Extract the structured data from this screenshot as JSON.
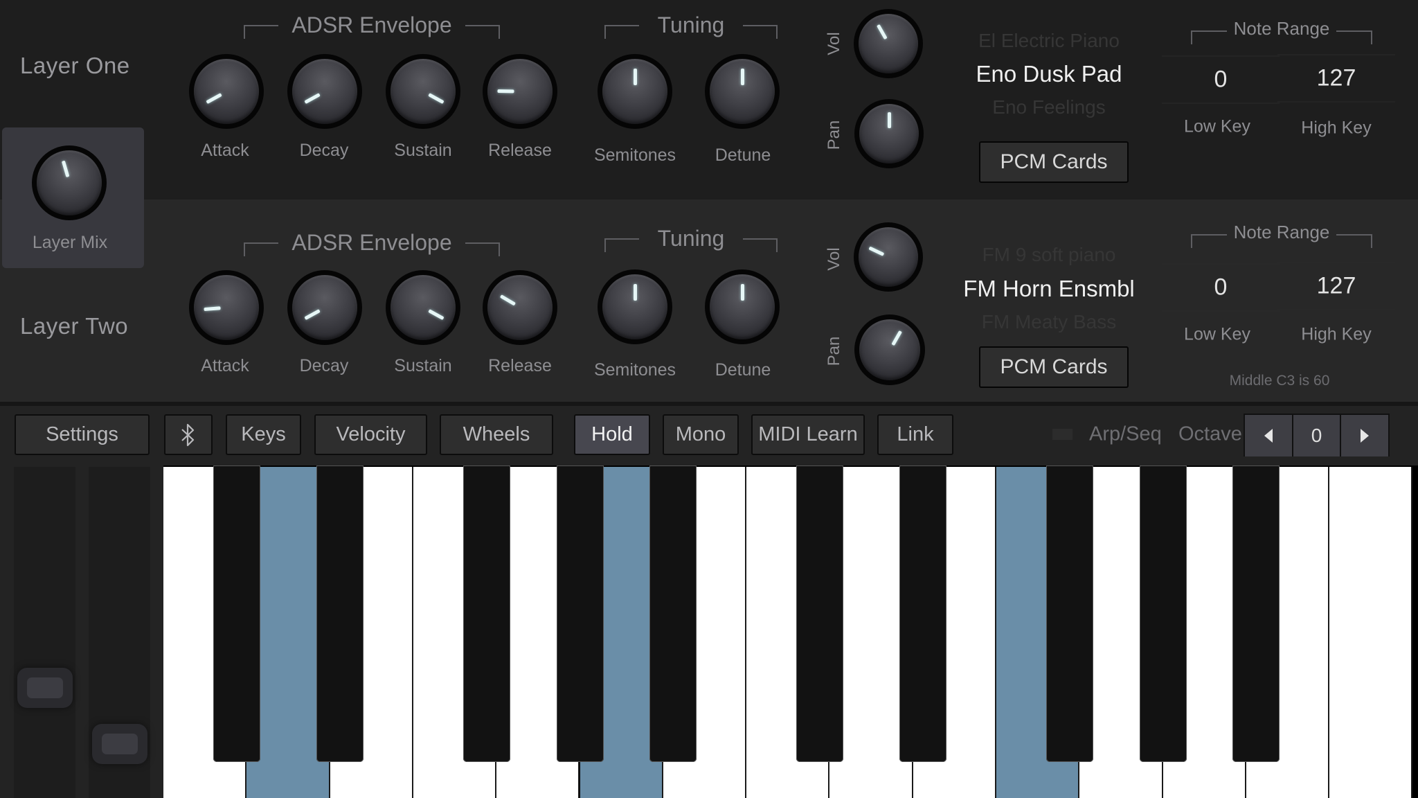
{
  "layers": [
    {
      "title": "Layer One",
      "adsr": {
        "title": "ADSR Envelope",
        "knobs": [
          {
            "label": "Attack",
            "value": 0.06
          },
          {
            "label": "Decay",
            "value": 0.06
          },
          {
            "label": "Sustain",
            "value": 0.94
          },
          {
            "label": "Release",
            "value": 0.17
          }
        ]
      },
      "tuning": {
        "title": "Tuning",
        "knobs": [
          {
            "label": "Semitones",
            "value": 0.5
          },
          {
            "label": "Detune",
            "value": 0.5
          }
        ]
      },
      "vol": {
        "label": "Vol",
        "value": 0.39
      },
      "pan": {
        "label": "Pan",
        "value": 0.5
      },
      "preset": {
        "above": "El Electric Piano",
        "selected": "Eno Dusk Pad",
        "below": "Eno Feelings"
      },
      "bank_button": "PCM Cards",
      "note_range": {
        "title": "Note Range",
        "low": "0",
        "high": "127",
        "low_label": "Low Key",
        "high_label": "High Key"
      }
    },
    {
      "title": "Layer Two",
      "adsr": {
        "title": "ADSR Envelope",
        "knobs": [
          {
            "label": "Attack",
            "value": 0.15
          },
          {
            "label": "Decay",
            "value": 0.06
          },
          {
            "label": "Sustain",
            "value": 0.94
          },
          {
            "label": "Release",
            "value": 0.28
          }
        ]
      },
      "tuning": {
        "title": "Tuning",
        "knobs": [
          {
            "label": "Semitones",
            "value": 0.5
          },
          {
            "label": "Detune",
            "value": 0.5
          }
        ]
      },
      "vol": {
        "label": "Vol",
        "value": 0.26
      },
      "pan": {
        "label": "Pan",
        "value": 0.61
      },
      "preset": {
        "above": "FM 9 soft piano",
        "selected": "FM Horn Ensmbl",
        "below": "FM Meaty Bass"
      },
      "bank_button": "PCM Cards",
      "note_range": {
        "title": "Note Range",
        "low": "0",
        "high": "127",
        "low_label": "Low Key",
        "high_label": "High Key"
      },
      "hint": "Middle C3 is 60"
    }
  ],
  "layer_mix": {
    "label": "Layer Mix",
    "value": 0.44
  },
  "toolbar": {
    "settings": "Settings",
    "bluetooth_icon": "bluetooth-icon",
    "keys": "Keys",
    "velocity": "Velocity",
    "wheels": "Wheels",
    "hold": "Hold",
    "hold_active": true,
    "mono": "Mono",
    "midi_learn": "MIDI Learn",
    "link": "Link",
    "arp_seq": "Arp/Seq",
    "arp_seq_on": false,
    "octave_label": "Octave",
    "octave_value": "0",
    "octave_down_icon": "triangle-left-icon",
    "octave_up_icon": "triangle-right-icon"
  },
  "wheels": {
    "pitch_value": 0.28,
    "mod_value": 0.11
  },
  "keyboard": {
    "white_keys": [
      "C",
      "D",
      "E",
      "F",
      "G",
      "A",
      "B",
      "C",
      "D",
      "E",
      "F",
      "G",
      "A",
      "B",
      "C"
    ],
    "pressed_white_indices": [
      1,
      5,
      10
    ],
    "pressed_notes": [
      "D",
      "A",
      "F"
    ],
    "highlight_color": "#6a8ea8"
  }
}
